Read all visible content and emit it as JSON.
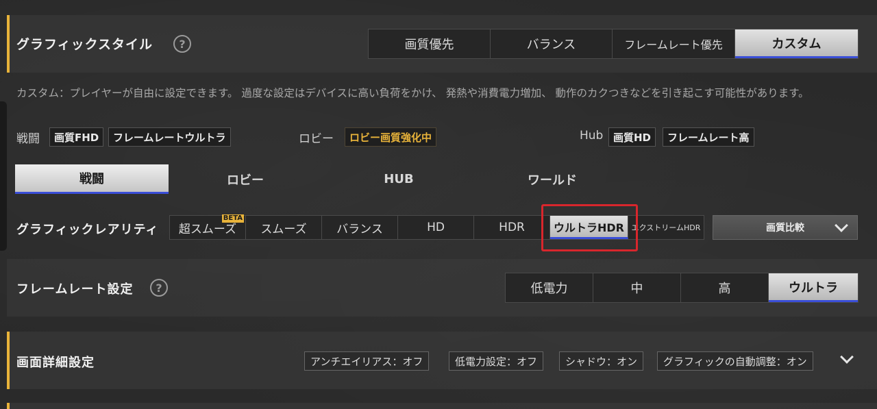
{
  "colors": {
    "accent_gold": "#e8b33a",
    "selected_underline": "#3a4ed8",
    "highlight_red": "#d8262c"
  },
  "graphic_style": {
    "title": "グラフィックスタイル",
    "help": "?",
    "options": [
      "画質優先",
      "バランス",
      "フレームレート優先",
      "カスタム"
    ],
    "selected": "カスタム"
  },
  "description": "カスタム：プレイヤーが自由に設定できます。 過度な設定はデバイスに高い負荷をかけ、 発熱や消費電力増加、 動作のカクつきなどを引き起こす可能性があります。",
  "summary": {
    "battle": {
      "label": "戦闘",
      "quality": "画質FHD",
      "framerate": "フレームレートウルトラ"
    },
    "lobby": {
      "label": "ロビー",
      "status": "ロビー画質強化中"
    },
    "hub": {
      "label": "Hub",
      "quality": "画質HD",
      "framerate": "フレームレート高"
    }
  },
  "mode_tabs": [
    "戦闘",
    "ロビー",
    "HUB",
    "ワールド"
  ],
  "graphics_quality": {
    "title": "グラフィックレアリティ",
    "options": [
      "超スムーズ",
      "スムーズ",
      "バランス",
      "HD",
      "HDR",
      "ウルトラHDR",
      "エクストリームHDR"
    ],
    "beta_badge": "BETA",
    "selected": "ウルトラHDR",
    "compare_label": "画質比較"
  },
  "framerate": {
    "title": "フレームレート設定",
    "help": "?",
    "options": [
      "低電力",
      "中",
      "高",
      "ウルトラ"
    ],
    "selected": "ウルトラ"
  },
  "screen_detail": {
    "title": "画面詳細設定",
    "chips": [
      "アンチエイリアス：オフ",
      "低電力設定：オフ",
      "シャドウ：オン",
      "グラフィックの自動調整：オン"
    ]
  }
}
